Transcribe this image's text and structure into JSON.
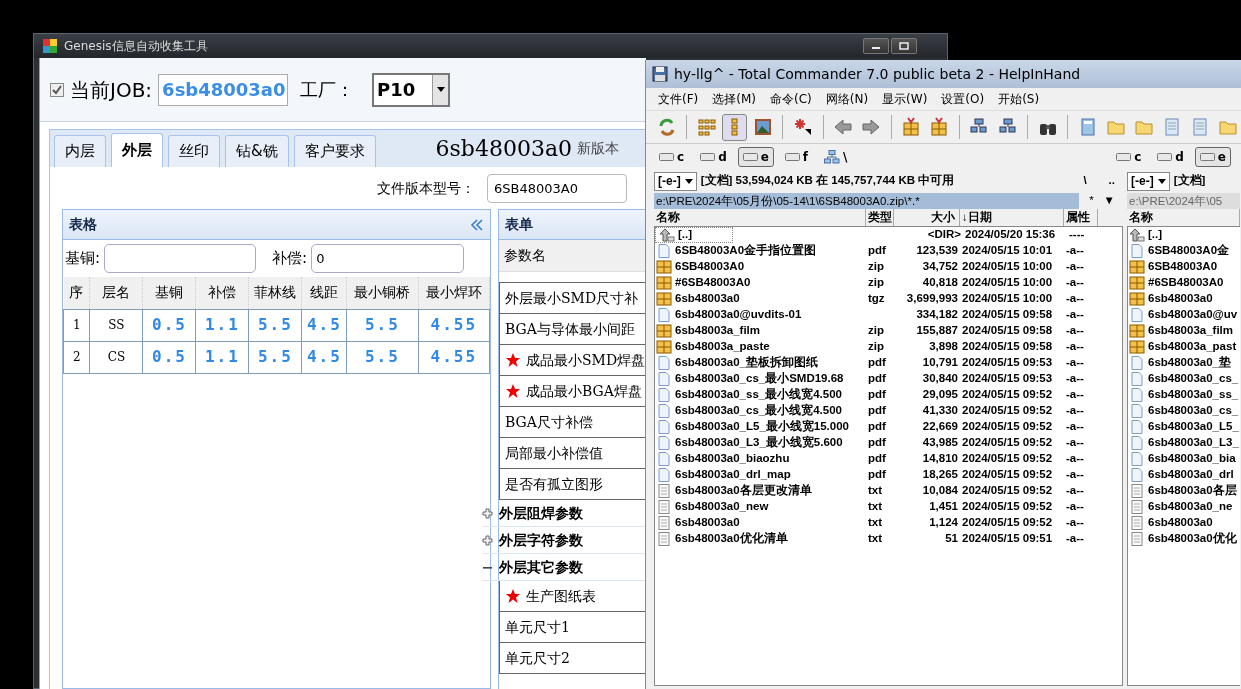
{
  "genesis": {
    "title": "Genesis信息自动收集工具",
    "job": {
      "checked": true,
      "label": "当前JOB:",
      "value": "6sb48003a0"
    },
    "factory": {
      "label": "工厂：",
      "value": "P10"
    },
    "tabs": [
      {
        "label": "内层",
        "selected": false
      },
      {
        "label": "外层",
        "selected": true
      },
      {
        "label": "丝印",
        "selected": false
      },
      {
        "label": "钻&铣",
        "selected": false
      },
      {
        "label": "客户要求",
        "selected": false
      }
    ],
    "job_banner": "6sb48003a0",
    "version_note": "新版本",
    "file_version": {
      "label": "文件版本型号：",
      "value": "6SB48003A0"
    },
    "grid_panel": {
      "title": "表格",
      "base_copper_label": "基铜:",
      "compensation_label": "补偿:",
      "compensation_value": "0",
      "columns": [
        "序",
        "层名",
        "基铜",
        "补偿",
        "菲林线",
        "线距",
        "最小铜桥",
        "最小焊环"
      ],
      "rows": [
        [
          "1",
          "SS",
          "0.5",
          "1.1",
          "5.5",
          "4.5",
          "5.5",
          "4.55"
        ],
        [
          "2",
          "CS",
          "0.5",
          "1.1",
          "5.5",
          "4.5",
          "5.5",
          "4.55"
        ]
      ]
    },
    "form_panel": {
      "title": "表单",
      "column": "参数名",
      "items": [
        {
          "kind": "param",
          "label": "外层最小SMD尺寸补",
          "required": false
        },
        {
          "kind": "param",
          "label": "BGA与导体最小间距",
          "required": false
        },
        {
          "kind": "param",
          "label": "成品最小SMD焊盘",
          "required": true
        },
        {
          "kind": "param",
          "label": "成品最小BGA焊盘",
          "required": true
        },
        {
          "kind": "param",
          "label": "BGA尺寸补偿",
          "required": false
        },
        {
          "kind": "param",
          "label": "局部最小补偿值",
          "required": false
        },
        {
          "kind": "param",
          "label": "是否有孤立图形",
          "required": false
        },
        {
          "kind": "group",
          "label": "外层阻焊参数",
          "expanded": false
        },
        {
          "kind": "group",
          "label": "外层字符参数",
          "expanded": false
        },
        {
          "kind": "group",
          "label": "外层其它参数",
          "expanded": true,
          "children": [
            {
              "kind": "param",
              "label": "生产图纸表",
              "required": true
            },
            {
              "kind": "param",
              "label": "单元尺寸1",
              "required": false
            },
            {
              "kind": "param",
              "label": "单元尺寸2",
              "required": false
            }
          ]
        }
      ]
    }
  },
  "commander": {
    "title": "hy-llg^ - Total Commander 7.0 public beta 2 - HelpInHand",
    "menu": [
      "文件(F)",
      "选择(M)",
      "命令(C)",
      "网络(N)",
      "显示(W)",
      "设置(O)",
      "开始(S)"
    ],
    "left_drives": [
      {
        "letter": "c",
        "selected": false
      },
      {
        "letter": "d",
        "selected": false
      },
      {
        "letter": "e",
        "selected": true
      },
      {
        "letter": "f",
        "selected": false
      }
    ],
    "root_button": "\\",
    "right_drives": [
      {
        "letter": "c",
        "selected": false
      },
      {
        "letter": "d",
        "selected": false
      },
      {
        "letter": "e",
        "selected": true
      }
    ],
    "left_panel": {
      "drive": "[-e-]",
      "space_info": "[文档]  53,594,024 KB 在 145,757,744 KB 中可用",
      "root": "\\",
      "up": "..",
      "path": "e:\\PRE\\2024年\\05月份\\05-14\\1\\6SB48003A0.zip\\*.*",
      "filter": "*",
      "history": "▼",
      "columns": [
        "名称",
        "类型",
        "大小",
        "↓日期",
        "属性"
      ],
      "files": [
        {
          "kind": "up",
          "name": "[..]",
          "size": "<DIR>",
          "date": "2024/05/20 15:36",
          "attr": "----",
          "selected": true
        },
        {
          "kind": "doc",
          "name": "6SB48003A0金手指位置图",
          "type": "pdf",
          "size": "123,539",
          "date": "2024/05/15 10:01",
          "attr": "-a--",
          "selected": false
        },
        {
          "kind": "archive",
          "name": "6SB48003A0",
          "type": "zip",
          "size": "34,752",
          "date": "2024/05/15 10:00",
          "attr": "-a--",
          "selected": false
        },
        {
          "kind": "archive",
          "name": "#6SB48003A0",
          "type": "zip",
          "size": "40,818",
          "date": "2024/05/15 10:00",
          "attr": "-a--",
          "selected": false
        },
        {
          "kind": "archive",
          "name": "6sb48003a0",
          "type": "tgz",
          "size": "3,699,993",
          "date": "2024/05/15 10:00",
          "attr": "-a--",
          "selected": false
        },
        {
          "kind": "doc",
          "name": "6sb48003a0@uvdits-01",
          "size": "334,182",
          "date": "2024/05/15 09:58",
          "attr": "-a--",
          "selected": false
        },
        {
          "kind": "archive",
          "name": "6sb48003a_film",
          "type": "zip",
          "size": "155,887",
          "date": "2024/05/15 09:58",
          "attr": "-a--",
          "selected": false
        },
        {
          "kind": "archive",
          "name": "6sb48003a_paste",
          "type": "zip",
          "size": "3,898",
          "date": "2024/05/15 09:58",
          "attr": "-a--",
          "selected": false
        },
        {
          "kind": "doc",
          "name": "6sb48003a0_垫板拆卸图纸",
          "type": "pdf",
          "size": "10,791",
          "date": "2024/05/15 09:53",
          "attr": "-a--",
          "selected": false
        },
        {
          "kind": "doc",
          "name": "6sb48003a0_cs_最小SMD19.68",
          "type": "pdf",
          "size": "30,840",
          "date": "2024/05/15 09:53",
          "attr": "-a--",
          "selected": false
        },
        {
          "kind": "doc",
          "name": "6sb48003a0_ss_最小线宽4.500",
          "type": "pdf",
          "size": "29,095",
          "date": "2024/05/15 09:52",
          "attr": "-a--",
          "selected": false
        },
        {
          "kind": "doc",
          "name": "6sb48003a0_cs_最小线宽4.500",
          "type": "pdf",
          "size": "41,330",
          "date": "2024/05/15 09:52",
          "attr": "-a--",
          "selected": false
        },
        {
          "kind": "doc",
          "name": "6sb48003a0_L5_最小线宽15.000",
          "type": "pdf",
          "size": "22,669",
          "date": "2024/05/15 09:52",
          "attr": "-a--",
          "selected": false
        },
        {
          "kind": "doc",
          "name": "6sb48003a0_L3_最小线宽5.600",
          "type": "pdf",
          "size": "43,985",
          "date": "2024/05/15 09:52",
          "attr": "-a--",
          "selected": false
        },
        {
          "kind": "doc",
          "name": "6sb48003a0_biaozhu",
          "type": "pdf",
          "size": "14,810",
          "date": "2024/05/15 09:52",
          "attr": "-a--",
          "selected": false
        },
        {
          "kind": "doc",
          "name": "6sb48003a0_drl_map",
          "type": "pdf",
          "size": "18,265",
          "date": "2024/05/15 09:52",
          "attr": "-a--",
          "selected": false
        },
        {
          "kind": "text",
          "name": "6sb48003a0各层更改清单",
          "type": "txt",
          "size": "10,084",
          "date": "2024/05/15 09:52",
          "attr": "-a--",
          "selected": false
        },
        {
          "kind": "text",
          "name": "6sb48003a0_new",
          "type": "txt",
          "size": "1,451",
          "date": "2024/05/15 09:52",
          "attr": "-a--",
          "selected": false
        },
        {
          "kind": "text",
          "name": "6sb48003a0",
          "type": "txt",
          "size": "1,124",
          "date": "2024/05/15 09:52",
          "attr": "-a--",
          "selected": false
        },
        {
          "kind": "text",
          "name": "6sb48003a0优化清单",
          "type": "txt",
          "size": "51",
          "date": "2024/05/15 09:51",
          "attr": "-a--",
          "selected": false
        }
      ]
    },
    "right_panel": {
      "drive": "[-e-]",
      "space_info": "[文档]",
      "path": "e:\\PRE\\2024年\\05",
      "column": "名称",
      "files": [
        {
          "kind": "up",
          "name": "[..]"
        },
        {
          "kind": "doc",
          "name": "6SB48003A0金"
        },
        {
          "kind": "archive",
          "name": "6SB48003A0"
        },
        {
          "kind": "archive",
          "name": "#6SB48003A0"
        },
        {
          "kind": "archive",
          "name": "6sb48003a0"
        },
        {
          "kind": "doc",
          "name": "6sb48003a0@uv"
        },
        {
          "kind": "archive",
          "name": "6sb48003a_film"
        },
        {
          "kind": "archive",
          "name": "6sb48003a_past"
        },
        {
          "kind": "doc",
          "name": "6sb48003a0_垫"
        },
        {
          "kind": "doc",
          "name": "6sb48003a0_cs_"
        },
        {
          "kind": "doc",
          "name": "6sb48003a0_ss_"
        },
        {
          "kind": "doc",
          "name": "6sb48003a0_cs_"
        },
        {
          "kind": "doc",
          "name": "6sb48003a0_L5_"
        },
        {
          "kind": "doc",
          "name": "6sb48003a0_L3_"
        },
        {
          "kind": "doc",
          "name": "6sb48003a0_bia"
        },
        {
          "kind": "doc",
          "name": "6sb48003a0_drl"
        },
        {
          "kind": "text",
          "name": "6sb48003a0各层"
        },
        {
          "kind": "text",
          "name": "6sb48003a0_ne"
        },
        {
          "kind": "text",
          "name": "6sb48003a0"
        },
        {
          "kind": "text",
          "name": "6sb48003a0优化"
        }
      ]
    }
  }
}
